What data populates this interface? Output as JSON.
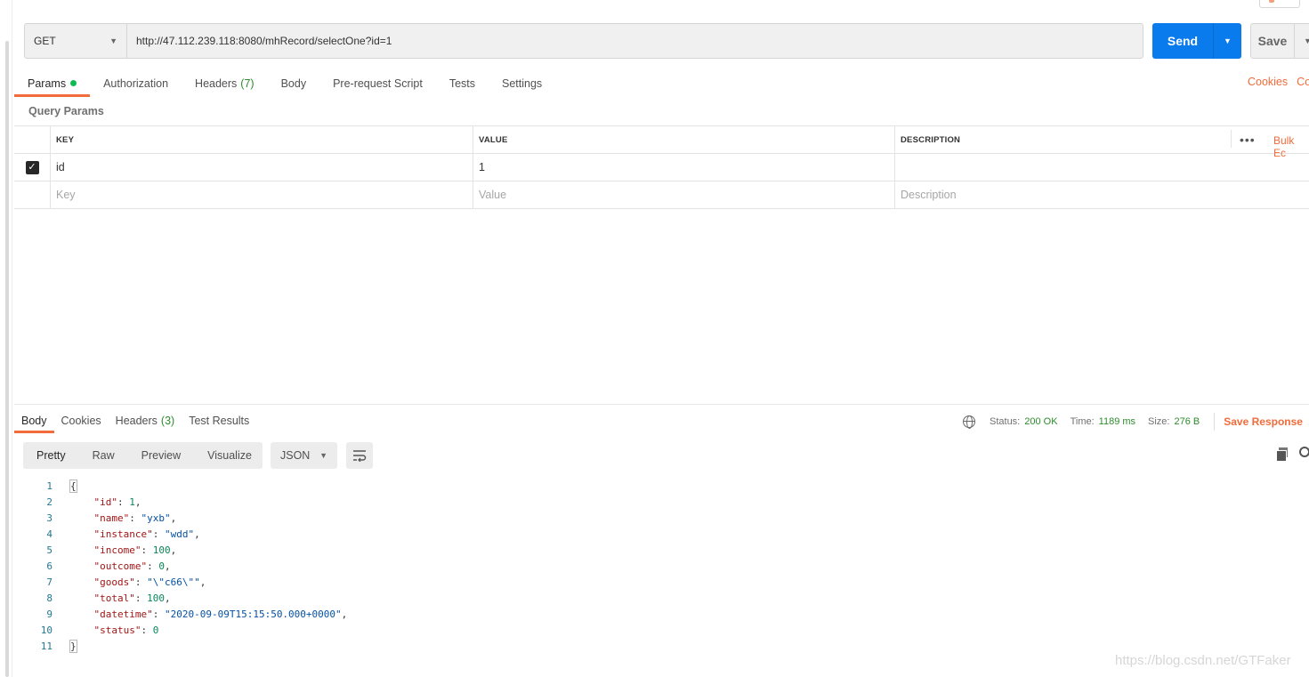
{
  "request": {
    "method": "GET",
    "url": "http://47.112.239.118:8080/mhRecord/selectOne?id=1",
    "send_label": "Send",
    "save_label": "Save"
  },
  "request_tabs": [
    {
      "label": "Params",
      "active": true
    },
    {
      "label": "Authorization"
    },
    {
      "label": "Headers",
      "count": "(7)"
    },
    {
      "label": "Body"
    },
    {
      "label": "Pre-request Script"
    },
    {
      "label": "Tests"
    },
    {
      "label": "Settings"
    }
  ],
  "right_links": {
    "cookies": "Cookies",
    "code": "Co"
  },
  "query_params": {
    "title": "Query Params",
    "headers": {
      "key": "KEY",
      "value": "VALUE",
      "description": "DESCRIPTION"
    },
    "bulk_edit": "Bulk Ec",
    "more": "•••",
    "rows": [
      {
        "checked": true,
        "key": "id",
        "value": "1",
        "description": ""
      }
    ],
    "placeholders": {
      "key": "Key",
      "value": "Value",
      "description": "Description"
    }
  },
  "response_tabs": [
    {
      "label": "Body",
      "active": true
    },
    {
      "label": "Cookies"
    },
    {
      "label": "Headers",
      "count": "(3)"
    },
    {
      "label": "Test Results"
    }
  ],
  "response_meta": {
    "status_label": "Status:",
    "status": "200 OK",
    "time_label": "Time:",
    "time": "1189 ms",
    "size_label": "Size:",
    "size": "276 B",
    "save_response": "Save Response"
  },
  "format_options": [
    "Pretty",
    "Raw",
    "Preview",
    "Visualize"
  ],
  "format_type": "JSON",
  "response_lines": [
    {
      "n": "1",
      "t": "brace",
      "text": "{"
    },
    {
      "n": "2",
      "key": "\"id\"",
      "val": "1",
      "type": "num",
      "comma": ","
    },
    {
      "n": "3",
      "key": "\"name\"",
      "val": "\"yxb\"",
      "type": "str",
      "comma": ","
    },
    {
      "n": "4",
      "key": "\"instance\"",
      "val": "\"wdd\"",
      "type": "str",
      "comma": ","
    },
    {
      "n": "5",
      "key": "\"income\"",
      "val": "100",
      "type": "num",
      "comma": ","
    },
    {
      "n": "6",
      "key": "\"outcome\"",
      "val": "0",
      "type": "num",
      "comma": ","
    },
    {
      "n": "7",
      "key": "\"goods\"",
      "val": "\"\\\"c66\\\"\"",
      "type": "str",
      "comma": ","
    },
    {
      "n": "8",
      "key": "\"total\"",
      "val": "100",
      "type": "num",
      "comma": ","
    },
    {
      "n": "9",
      "key": "\"datetime\"",
      "val": "\"2020-09-09T15:15:50.000+0000\"",
      "type": "str",
      "comma": ","
    },
    {
      "n": "10",
      "key": "\"status\"",
      "val": "0",
      "type": "num",
      "comma": ""
    },
    {
      "n": "11",
      "t": "brace",
      "text": "}"
    }
  ],
  "watermark": "https://blog.csdn.net/GTFaker",
  "colors": {
    "accent": "#f26b3a",
    "send": "#097bed",
    "status_green": "#2d8c2d"
  }
}
